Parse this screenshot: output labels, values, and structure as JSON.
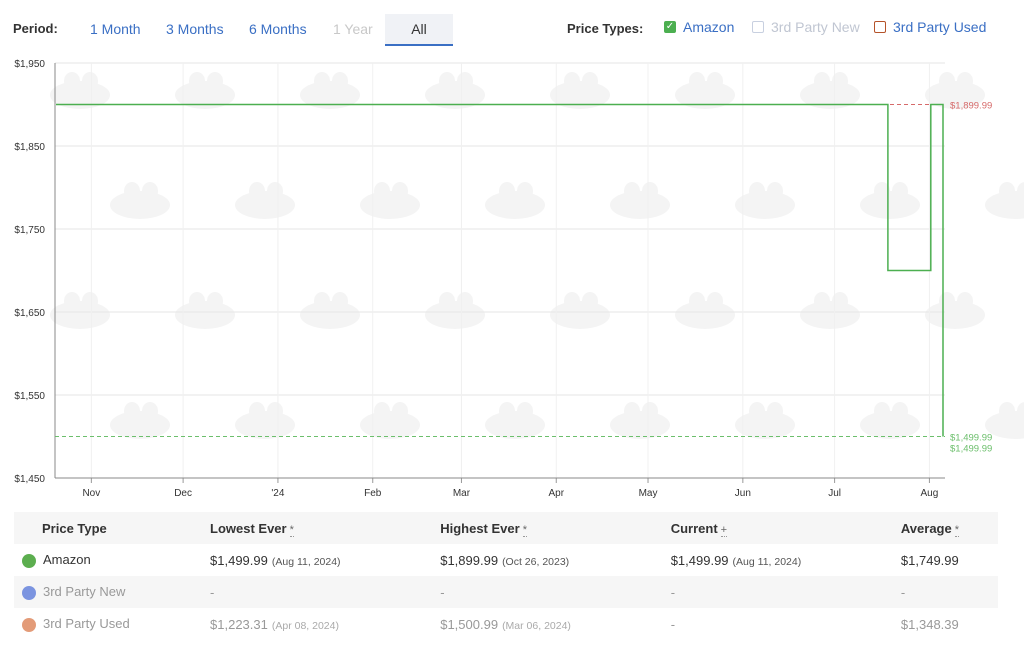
{
  "controls": {
    "period_label": "Period:",
    "periods": [
      {
        "label": "1 Month",
        "state": "enabled"
      },
      {
        "label": "3 Months",
        "state": "enabled"
      },
      {
        "label": "6 Months",
        "state": "enabled"
      },
      {
        "label": "1 Year",
        "state": "disabled"
      },
      {
        "label": "All",
        "state": "active"
      }
    ],
    "price_types_label": "Price Types:",
    "price_types": [
      {
        "label": "Amazon",
        "checked": true,
        "color": "#4caf50"
      },
      {
        "label": "3rd Party New",
        "checked": false,
        "color": "#c8d0e0"
      },
      {
        "label": "3rd Party Used",
        "checked": false,
        "color": "#b5532a"
      }
    ]
  },
  "chart_data": {
    "type": "line",
    "step": true,
    "ylim": [
      1450,
      1950
    ],
    "y_ticks": [
      "$1,950",
      "$1,850",
      "$1,750",
      "$1,650",
      "$1,550",
      "$1,450"
    ],
    "x_ticks": [
      "Nov",
      "Dec",
      "'24",
      "Feb",
      "Mar",
      "Apr",
      "May",
      "Jun",
      "Jul",
      "Aug"
    ],
    "grid": true,
    "series": [
      {
        "name": "Amazon",
        "color": "#4caf50",
        "points": [
          {
            "x": "2023-10-26",
            "y": 1899.99
          },
          {
            "x": "2024-07-24",
            "y": 1899.99
          },
          {
            "x": "2024-07-24",
            "y": 1699.99
          },
          {
            "x": "2024-08-07",
            "y": 1699.99
          },
          {
            "x": "2024-08-07",
            "y": 1899.99
          },
          {
            "x": "2024-08-11",
            "y": 1899.99
          },
          {
            "x": "2024-08-11",
            "y": 1499.99
          }
        ]
      }
    ],
    "reference_lines": [
      {
        "value": 1899.99,
        "label": "$1,899.99",
        "color": "#d66a6a"
      },
      {
        "value": 1499.99,
        "label": "$1,499.99",
        "color": "#6cbf6c"
      }
    ],
    "extra_labels": [
      {
        "value": 1499.99,
        "label": "$1,499.99",
        "color": "#6cbf6c"
      }
    ]
  },
  "table": {
    "headers": [
      "Price Type",
      "Lowest Ever",
      "Highest Ever",
      "Current",
      "Average"
    ],
    "header_marks": [
      "",
      "*",
      "*",
      "+",
      "*"
    ],
    "rows": [
      {
        "name": "Amazon",
        "dot_color": "#5cae4f",
        "muted": false,
        "lowest": "$1,499.99",
        "lowest_date": "(Aug 11, 2024)",
        "highest": "$1,899.99",
        "highest_date": "(Oct 26, 2023)",
        "current": "$1,499.99",
        "current_date": "(Aug 11, 2024)",
        "average": "$1,749.99"
      },
      {
        "name": "3rd Party New",
        "dot_color": "#7b94e0",
        "muted": true,
        "lowest": "-",
        "lowest_date": "",
        "highest": "-",
        "highest_date": "",
        "current": "-",
        "current_date": "",
        "average": "-"
      },
      {
        "name": "3rd Party Used",
        "dot_color": "#e39b78",
        "muted": true,
        "lowest": "$1,223.31",
        "lowest_date": "(Apr 08, 2024)",
        "highest": "$1,500.99",
        "highest_date": "(Mar 06, 2024)",
        "current": "-",
        "current_date": "",
        "average": "$1,348.39"
      }
    ]
  }
}
